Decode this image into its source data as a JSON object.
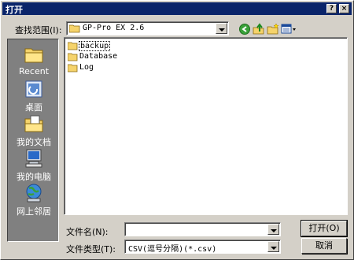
{
  "window": {
    "title": "打开"
  },
  "titlebar": {
    "help": "?",
    "close": "×"
  },
  "lookin": {
    "label": "查找范围(I):",
    "value": "GP-Pro EX 2.6"
  },
  "places": [
    {
      "label": "Recent",
      "icon": "recent-folder-icon"
    },
    {
      "label": "桌面",
      "icon": "desktop-icon"
    },
    {
      "label": "我的文档",
      "icon": "my-documents-icon"
    },
    {
      "label": "我的电脑",
      "icon": "my-computer-icon"
    },
    {
      "label": "网上邻居",
      "icon": "network-icon"
    }
  ],
  "files": [
    {
      "name": "backup",
      "selected": true
    },
    {
      "name": "Database",
      "selected": false
    },
    {
      "name": "Log",
      "selected": false
    }
  ],
  "filename": {
    "label": "文件名(N):",
    "value": ""
  },
  "filetype": {
    "label": "文件类型(T):",
    "value": "CSV(逗号分隔)(*.csv)"
  },
  "buttons": {
    "open": "打开(O)",
    "cancel": "取消"
  },
  "colors": {
    "titlebar": "#0a246a",
    "face": "#d4d0c8",
    "places_bg": "#808080"
  }
}
